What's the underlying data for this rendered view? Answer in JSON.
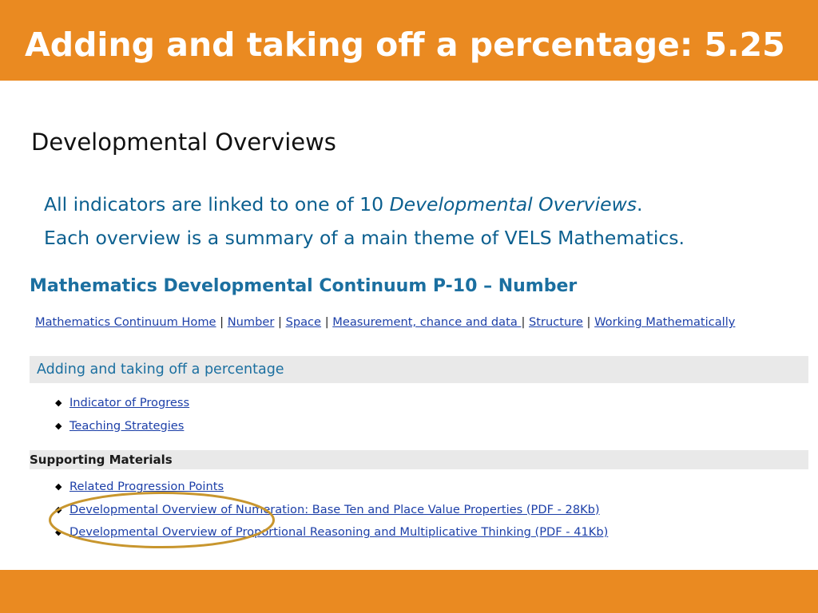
{
  "slide": {
    "title": "Adding and taking off a percentage: 5.25",
    "heading": "Developmental Overviews",
    "intro_line1_prefix": "All indicators are linked to one of 10 ",
    "intro_line1_emphasis": "Developmental Overviews",
    "intro_line1_suffix": ".",
    "intro_line2": "Each overview is a summary of a main theme of VELS Mathematics.",
    "accent_color": "#ea8a21",
    "text_blue": "#0b5f8f"
  },
  "webpage": {
    "title": "Mathematics Developmental Continuum P-10 – Number",
    "nav": [
      {
        "label": "Mathematics Continuum Home"
      },
      {
        "label": "Number"
      },
      {
        "label": "Space"
      },
      {
        "label": "Measurement, chance and data "
      },
      {
        "label": "Structure"
      },
      {
        "label": "Working Mathematically"
      }
    ],
    "nav_separator": "|",
    "section_title": "Adding and taking off a percentage",
    "section_links": [
      {
        "label": "Indicator of Progress"
      },
      {
        "label": "Teaching Strategies"
      }
    ],
    "supporting_title": "Supporting Materials",
    "supporting_links": [
      {
        "label": "Related Progression Points"
      },
      {
        "label": "Developmental Overview of Numeration: Base Ten and Place Value Properties (PDF - 28Kb)"
      },
      {
        "label": "Developmental Overview of Proportional Reasoning and Multiplicative Thinking (PDF - 41Kb)"
      }
    ],
    "link_color": "#1c3fa8",
    "highlight_color": "#c8962e"
  }
}
